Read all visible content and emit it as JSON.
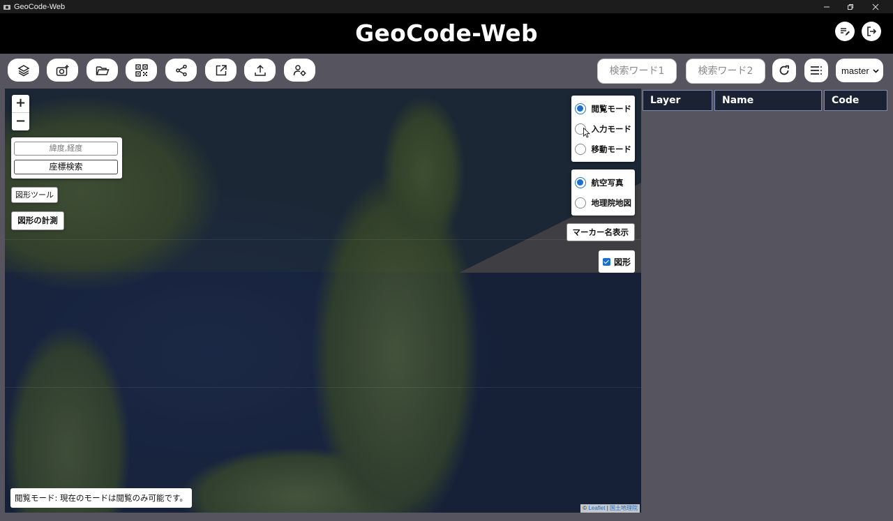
{
  "window": {
    "title": "GeoCode-Web"
  },
  "header": {
    "title": "GeoCode-Web"
  },
  "toolbar": {
    "buttons": [
      "layers-icon",
      "add-photo-icon",
      "folder-open-icon",
      "qr-code-icon",
      "share-icon",
      "open-external-icon",
      "upload-icon",
      "user-settings-icon"
    ],
    "search1_placeholder": "検索ワード1",
    "search2_placeholder": "検索ワード2",
    "branch": "master"
  },
  "map": {
    "zoom_in": "+",
    "zoom_out": "−",
    "coord_placeholder": "緯度,経度",
    "coord_search": "座標検索",
    "shape_tool": "図形ツール",
    "shape_measure": "図形の計測",
    "modes": [
      {
        "label": "閲覧モード",
        "checked": true
      },
      {
        "label": "入力モード",
        "checked": false
      },
      {
        "label": "移動モード",
        "checked": false
      }
    ],
    "basemaps": [
      {
        "label": "航空写真",
        "checked": true
      },
      {
        "label": "地理院地図",
        "checked": false
      }
    ],
    "marker_names": "マーカー名表示",
    "shape_toggle": "図形",
    "status": "閲覧モード: 現在のモードは閲覧のみ可能です。",
    "attribution_leaflet": "Leaflet",
    "attribution_gsi": "国土地理院",
    "attribution_sep": "| "
  },
  "table": {
    "columns": [
      "Layer",
      "Name",
      "Code"
    ],
    "rows": []
  },
  "colors": {
    "header_bg": "#000000",
    "page_bg": "#56555f",
    "accent": "#1b70cf",
    "table_header_bg": "#1a2233"
  }
}
